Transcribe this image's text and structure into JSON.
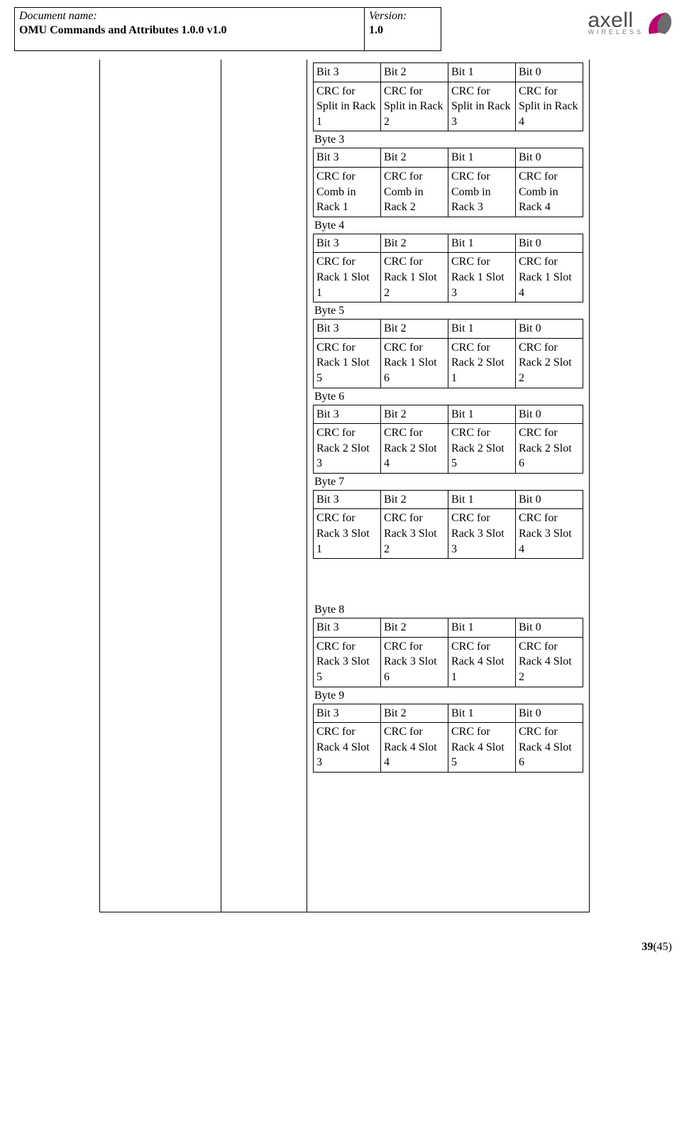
{
  "header": {
    "doc_name_label": "Document name:",
    "doc_name_value": "OMU Commands and Attributes 1.0.0 v1.0",
    "version_label": "Version:",
    "version_value": "1.0",
    "logo_line1": "axell",
    "logo_line2": "WIRELESS"
  },
  "bytes": [
    {
      "label": "",
      "bits": [
        "Bit 3",
        "Bit 2",
        "Bit 1",
        "Bit 0"
      ],
      "cells": [
        "CRC for Split in Rack 1",
        "CRC for Split in Rack 2",
        "CRC for Split in Rack 3",
        "CRC for Split in Rack 4"
      ]
    },
    {
      "label": "Byte 3",
      "bits": [
        "Bit 3",
        "Bit 2",
        "Bit 1",
        "Bit 0"
      ],
      "cells": [
        "CRC for Comb in Rack 1",
        "CRC for Comb in Rack 2",
        "CRC for Comb in Rack 3",
        "CRC for Comb in Rack 4"
      ]
    },
    {
      "label": "Byte 4",
      "bits": [
        "Bit 3",
        "Bit 2",
        "Bit 1",
        "Bit 0"
      ],
      "cells": [
        "CRC for Rack 1 Slot 1",
        "CRC for Rack 1 Slot 2",
        "CRC for Rack 1 Slot 3",
        "CRC for Rack 1 Slot 4"
      ]
    },
    {
      "label": "Byte 5",
      "bits": [
        "Bit 3",
        "Bit 2",
        "Bit 1",
        "Bit 0"
      ],
      "cells": [
        "CRC for Rack 1 Slot 5",
        "CRC for Rack 1 Slot 6",
        "CRC for Rack 2 Slot 1",
        "CRC for Rack 2 Slot 2"
      ]
    },
    {
      "label": "Byte 6",
      "bits": [
        "Bit 3",
        "Bit 2",
        "Bit 1",
        "Bit 0"
      ],
      "cells": [
        "CRC for Rack 2 Slot 3",
        "CRC for Rack 2 Slot 4",
        "CRC for Rack 2 Slot 5",
        "CRC for Rack 2 Slot 6"
      ]
    },
    {
      "label": "Byte 7",
      "bits": [
        "Bit 3",
        "Bit 2",
        "Bit 1",
        "Bit 0"
      ],
      "cells": [
        "CRC for Rack 3 Slot 1",
        "CRC for Rack 3 Slot 2",
        "CRC for Rack 3 Slot 3",
        "CRC for Rack 3 Slot 4"
      ],
      "spacer_after": true
    },
    {
      "label": "Byte 8",
      "bits": [
        "Bit 3",
        "Bit 2",
        "Bit 1",
        "Bit 0"
      ],
      "cells": [
        "CRC for Rack 3 Slot 5",
        "CRC for Rack 3 Slot 6",
        "CRC for Rack 4 Slot 1",
        "CRC for Rack 4 Slot 2"
      ]
    },
    {
      "label": "Byte 9",
      "bits": [
        "Bit 3",
        "Bit 2",
        "Bit 1",
        "Bit 0"
      ],
      "cells": [
        "CRC for Rack 4 Slot 3",
        "CRC for Rack 4 Slot 4",
        "CRC for Rack 4 Slot 5",
        "CRC for Rack 4 Slot 6"
      ]
    }
  ],
  "footer": {
    "page_current": "39",
    "page_total": "(45)"
  }
}
